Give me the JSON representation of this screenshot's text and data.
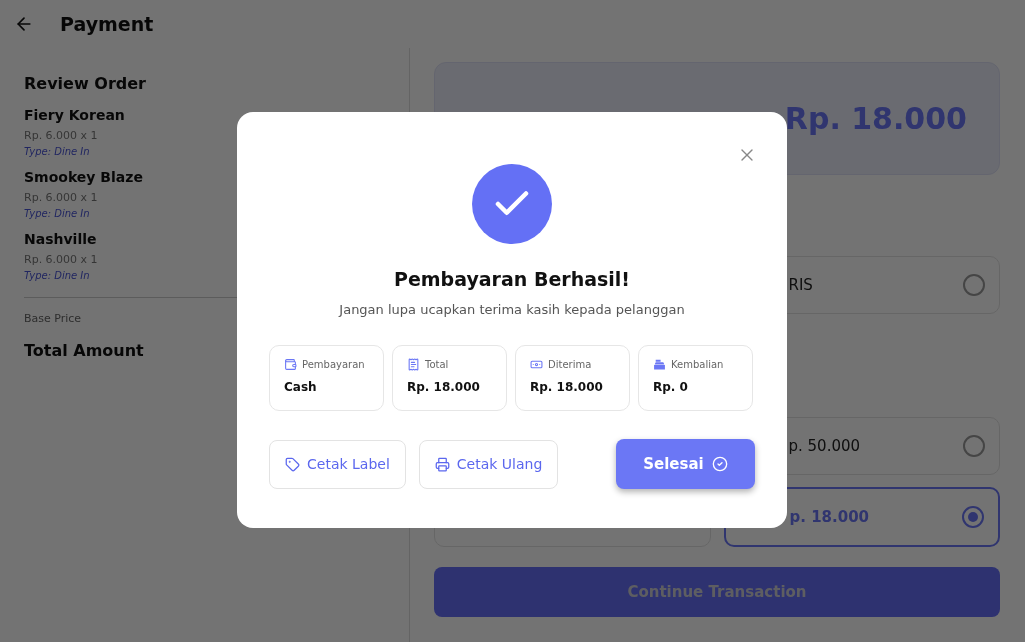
{
  "header": {
    "title": "Payment"
  },
  "review": {
    "title": "Review Order",
    "items": [
      {
        "name": "Fiery Korean",
        "price": "Rp. 6.000 x 1",
        "type": "Type: Dine In"
      },
      {
        "name": "Smookey Blaze",
        "price": "Rp. 6.000 x 1",
        "type": "Type: Dine In"
      },
      {
        "name": "Nashville",
        "price": "Rp. 6.000 x 1",
        "type": "Type: Dine In"
      }
    ],
    "base_price_label": "Base Price",
    "total_label": "Total Amount"
  },
  "total_card": {
    "amount": "Rp. 18.000"
  },
  "payment_methods": [
    {
      "label": "RIS",
      "selected": false
    }
  ],
  "amounts": [
    {
      "label": "p. 50.000",
      "selected": false
    },
    {
      "label": "p. 18.000",
      "selected": true
    }
  ],
  "continue_button": "Continue Transaction",
  "dialog": {
    "title": "Pembayaran Berhasil!",
    "message": "Jangan lupa ucapkan terima kasih kepada pelanggan",
    "info": [
      {
        "label": "Pembayaran",
        "value": "Cash"
      },
      {
        "label": "Total",
        "value": "Rp. 18.000"
      },
      {
        "label": "Diterima",
        "value": "Rp. 18.000"
      },
      {
        "label": "Kembalian",
        "value": "Rp. 0"
      }
    ],
    "buttons": [
      {
        "label": "Cetak Label",
        "kind": "label"
      },
      {
        "label": "Cetak Ulang",
        "kind": "print"
      },
      {
        "label": "Selesai",
        "kind": "done"
      }
    ]
  }
}
